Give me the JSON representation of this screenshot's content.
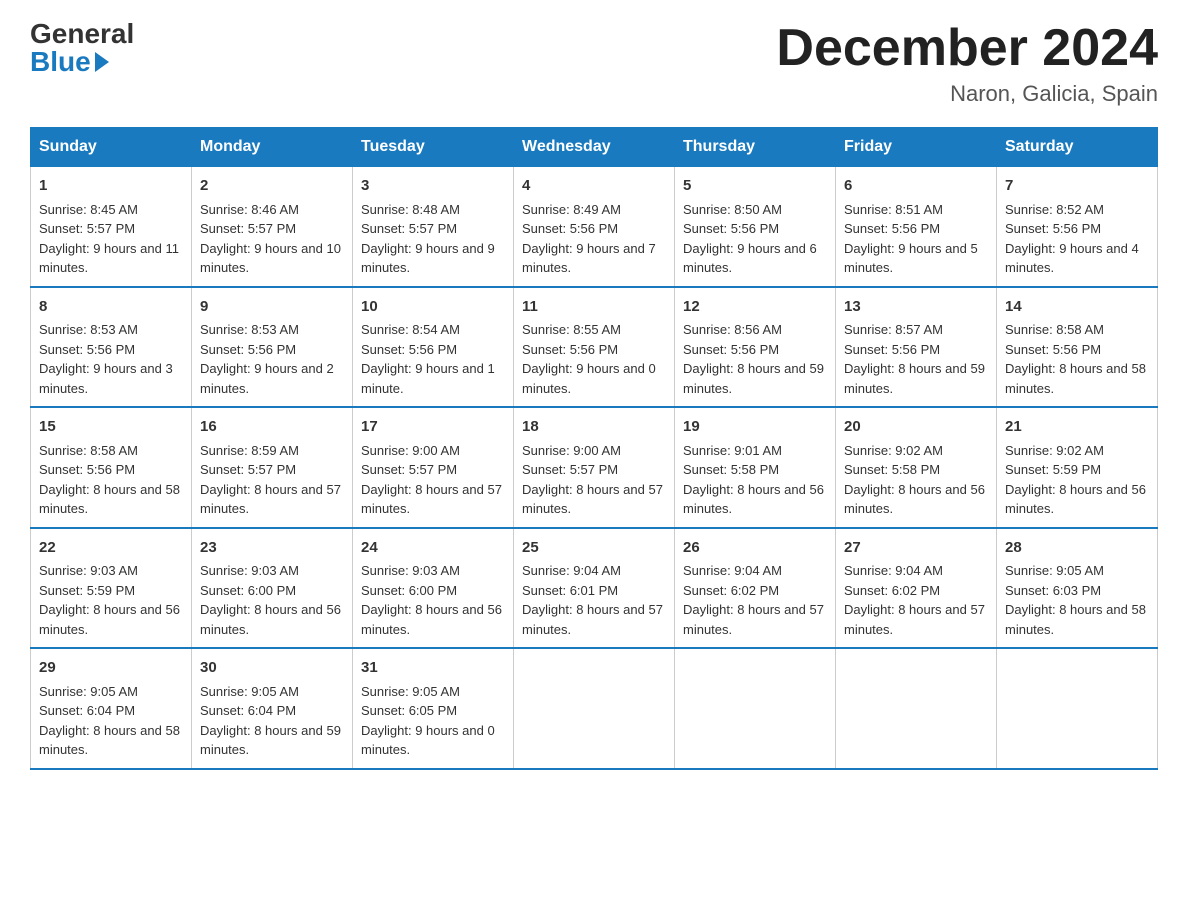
{
  "header": {
    "logo_general": "General",
    "logo_blue": "Blue",
    "main_title": "December 2024",
    "subtitle": "Naron, Galicia, Spain"
  },
  "days_of_week": [
    "Sunday",
    "Monday",
    "Tuesday",
    "Wednesday",
    "Thursday",
    "Friday",
    "Saturday"
  ],
  "weeks": [
    [
      {
        "day": "1",
        "sunrise": "8:45 AM",
        "sunset": "5:57 PM",
        "daylight": "9 hours and 11 minutes."
      },
      {
        "day": "2",
        "sunrise": "8:46 AM",
        "sunset": "5:57 PM",
        "daylight": "9 hours and 10 minutes."
      },
      {
        "day": "3",
        "sunrise": "8:48 AM",
        "sunset": "5:57 PM",
        "daylight": "9 hours and 9 minutes."
      },
      {
        "day": "4",
        "sunrise": "8:49 AM",
        "sunset": "5:56 PM",
        "daylight": "9 hours and 7 minutes."
      },
      {
        "day": "5",
        "sunrise": "8:50 AM",
        "sunset": "5:56 PM",
        "daylight": "9 hours and 6 minutes."
      },
      {
        "day": "6",
        "sunrise": "8:51 AM",
        "sunset": "5:56 PM",
        "daylight": "9 hours and 5 minutes."
      },
      {
        "day": "7",
        "sunrise": "8:52 AM",
        "sunset": "5:56 PM",
        "daylight": "9 hours and 4 minutes."
      }
    ],
    [
      {
        "day": "8",
        "sunrise": "8:53 AM",
        "sunset": "5:56 PM",
        "daylight": "9 hours and 3 minutes."
      },
      {
        "day": "9",
        "sunrise": "8:53 AM",
        "sunset": "5:56 PM",
        "daylight": "9 hours and 2 minutes."
      },
      {
        "day": "10",
        "sunrise": "8:54 AM",
        "sunset": "5:56 PM",
        "daylight": "9 hours and 1 minute."
      },
      {
        "day": "11",
        "sunrise": "8:55 AM",
        "sunset": "5:56 PM",
        "daylight": "9 hours and 0 minutes."
      },
      {
        "day": "12",
        "sunrise": "8:56 AM",
        "sunset": "5:56 PM",
        "daylight": "8 hours and 59 minutes."
      },
      {
        "day": "13",
        "sunrise": "8:57 AM",
        "sunset": "5:56 PM",
        "daylight": "8 hours and 59 minutes."
      },
      {
        "day": "14",
        "sunrise": "8:58 AM",
        "sunset": "5:56 PM",
        "daylight": "8 hours and 58 minutes."
      }
    ],
    [
      {
        "day": "15",
        "sunrise": "8:58 AM",
        "sunset": "5:56 PM",
        "daylight": "8 hours and 58 minutes."
      },
      {
        "day": "16",
        "sunrise": "8:59 AM",
        "sunset": "5:57 PM",
        "daylight": "8 hours and 57 minutes."
      },
      {
        "day": "17",
        "sunrise": "9:00 AM",
        "sunset": "5:57 PM",
        "daylight": "8 hours and 57 minutes."
      },
      {
        "day": "18",
        "sunrise": "9:00 AM",
        "sunset": "5:57 PM",
        "daylight": "8 hours and 57 minutes."
      },
      {
        "day": "19",
        "sunrise": "9:01 AM",
        "sunset": "5:58 PM",
        "daylight": "8 hours and 56 minutes."
      },
      {
        "day": "20",
        "sunrise": "9:02 AM",
        "sunset": "5:58 PM",
        "daylight": "8 hours and 56 minutes."
      },
      {
        "day": "21",
        "sunrise": "9:02 AM",
        "sunset": "5:59 PM",
        "daylight": "8 hours and 56 minutes."
      }
    ],
    [
      {
        "day": "22",
        "sunrise": "9:03 AM",
        "sunset": "5:59 PM",
        "daylight": "8 hours and 56 minutes."
      },
      {
        "day": "23",
        "sunrise": "9:03 AM",
        "sunset": "6:00 PM",
        "daylight": "8 hours and 56 minutes."
      },
      {
        "day": "24",
        "sunrise": "9:03 AM",
        "sunset": "6:00 PM",
        "daylight": "8 hours and 56 minutes."
      },
      {
        "day": "25",
        "sunrise": "9:04 AM",
        "sunset": "6:01 PM",
        "daylight": "8 hours and 57 minutes."
      },
      {
        "day": "26",
        "sunrise": "9:04 AM",
        "sunset": "6:02 PM",
        "daylight": "8 hours and 57 minutes."
      },
      {
        "day": "27",
        "sunrise": "9:04 AM",
        "sunset": "6:02 PM",
        "daylight": "8 hours and 57 minutes."
      },
      {
        "day": "28",
        "sunrise": "9:05 AM",
        "sunset": "6:03 PM",
        "daylight": "8 hours and 58 minutes."
      }
    ],
    [
      {
        "day": "29",
        "sunrise": "9:05 AM",
        "sunset": "6:04 PM",
        "daylight": "8 hours and 58 minutes."
      },
      {
        "day": "30",
        "sunrise": "9:05 AM",
        "sunset": "6:04 PM",
        "daylight": "8 hours and 59 minutes."
      },
      {
        "day": "31",
        "sunrise": "9:05 AM",
        "sunset": "6:05 PM",
        "daylight": "9 hours and 0 minutes."
      },
      null,
      null,
      null,
      null
    ]
  ]
}
